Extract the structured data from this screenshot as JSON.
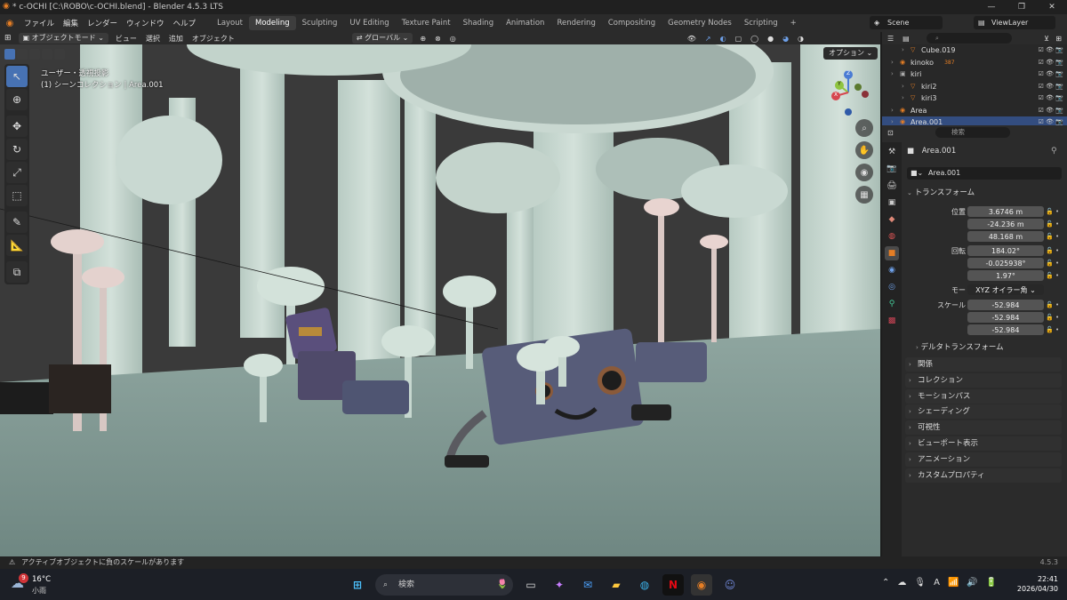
{
  "window": {
    "title": "* c-OCHI [C:\\ROBO\\c-OCHI.blend] - Blender 4.5.3 LTS",
    "minimize": "—",
    "maximize": "❐",
    "close": "✕"
  },
  "menu": {
    "items": [
      "ファイル",
      "編集",
      "レンダー",
      "ウィンドウ",
      "ヘルプ"
    ],
    "workspaces": [
      "Layout",
      "Modeling",
      "Sculpting",
      "UV Editing",
      "Texture Paint",
      "Shading",
      "Animation",
      "Rendering",
      "Compositing",
      "Geometry Nodes",
      "Scripting"
    ],
    "active_workspace": "Modeling",
    "add_tab": "+",
    "scene": "Scene",
    "view_layer": "ViewLayer"
  },
  "viewport_header": {
    "mode": "オブジェクトモード",
    "menus": [
      "ビュー",
      "選択",
      "追加",
      "オブジェクト"
    ],
    "orientation": "グローバル",
    "options": "オプション"
  },
  "viewport_overlay": {
    "view_name": "ユーザー・透視投影",
    "collection_info": "(1) シーンコレクション | Area.001"
  },
  "gizmo": {
    "z": "Z",
    "y": "Y",
    "x": "X"
  },
  "outliner": {
    "search_placeholder": "",
    "rows": [
      {
        "name": "Cube.019",
        "indent": 1
      },
      {
        "name": "kinoko",
        "indent": 0,
        "badge": "387"
      },
      {
        "name": "kiri",
        "indent": 0
      },
      {
        "name": "kiri2",
        "indent": 1
      },
      {
        "name": "kiri3",
        "indent": 1
      },
      {
        "name": "Area",
        "indent": 0
      },
      {
        "name": "Area.001",
        "indent": 0
      }
    ]
  },
  "properties": {
    "search_placeholder": "検索",
    "object_name": "Area.001",
    "data_name": "Area.001",
    "transform_title": "トランスフォーム",
    "location": {
      "label_x": "位置 X",
      "x": "3.6746 m",
      "y": "-24.236 m",
      "z": "48.168 m"
    },
    "rotation": {
      "label_x": "回転 X",
      "x": "184.02°",
      "y": "-0.025938°",
      "z": "1.97°"
    },
    "mode_label": "モード",
    "mode_value": "XYZ オイラー角",
    "scale": {
      "label_x": "スケール X",
      "x": "-52.984",
      "y": "-52.984",
      "z": "-52.984"
    },
    "axis_y": "Y",
    "axis_z": "Z",
    "delta_transform": "デルタトランスフォーム",
    "panels": [
      "関係",
      "コレクション",
      "モーションパス",
      "シェーディング",
      "可視性",
      "ビューポート表示",
      "アニメーション",
      "カスタムプロパティ"
    ]
  },
  "statusbar": {
    "warning": "アクティブオブジェクトに負のスケールがあります",
    "version": "4.5.3"
  },
  "taskbar": {
    "weather_temp": "16°C",
    "weather_desc": "小雨",
    "weather_badge": "9",
    "search_placeholder": "検索",
    "time": "22:41",
    "date": "2026/04/30",
    "ime": "A"
  },
  "colors": {
    "accent": "#4772b3",
    "active_tab": "#e57e25",
    "viewport_bg": "#2f2f2f"
  }
}
